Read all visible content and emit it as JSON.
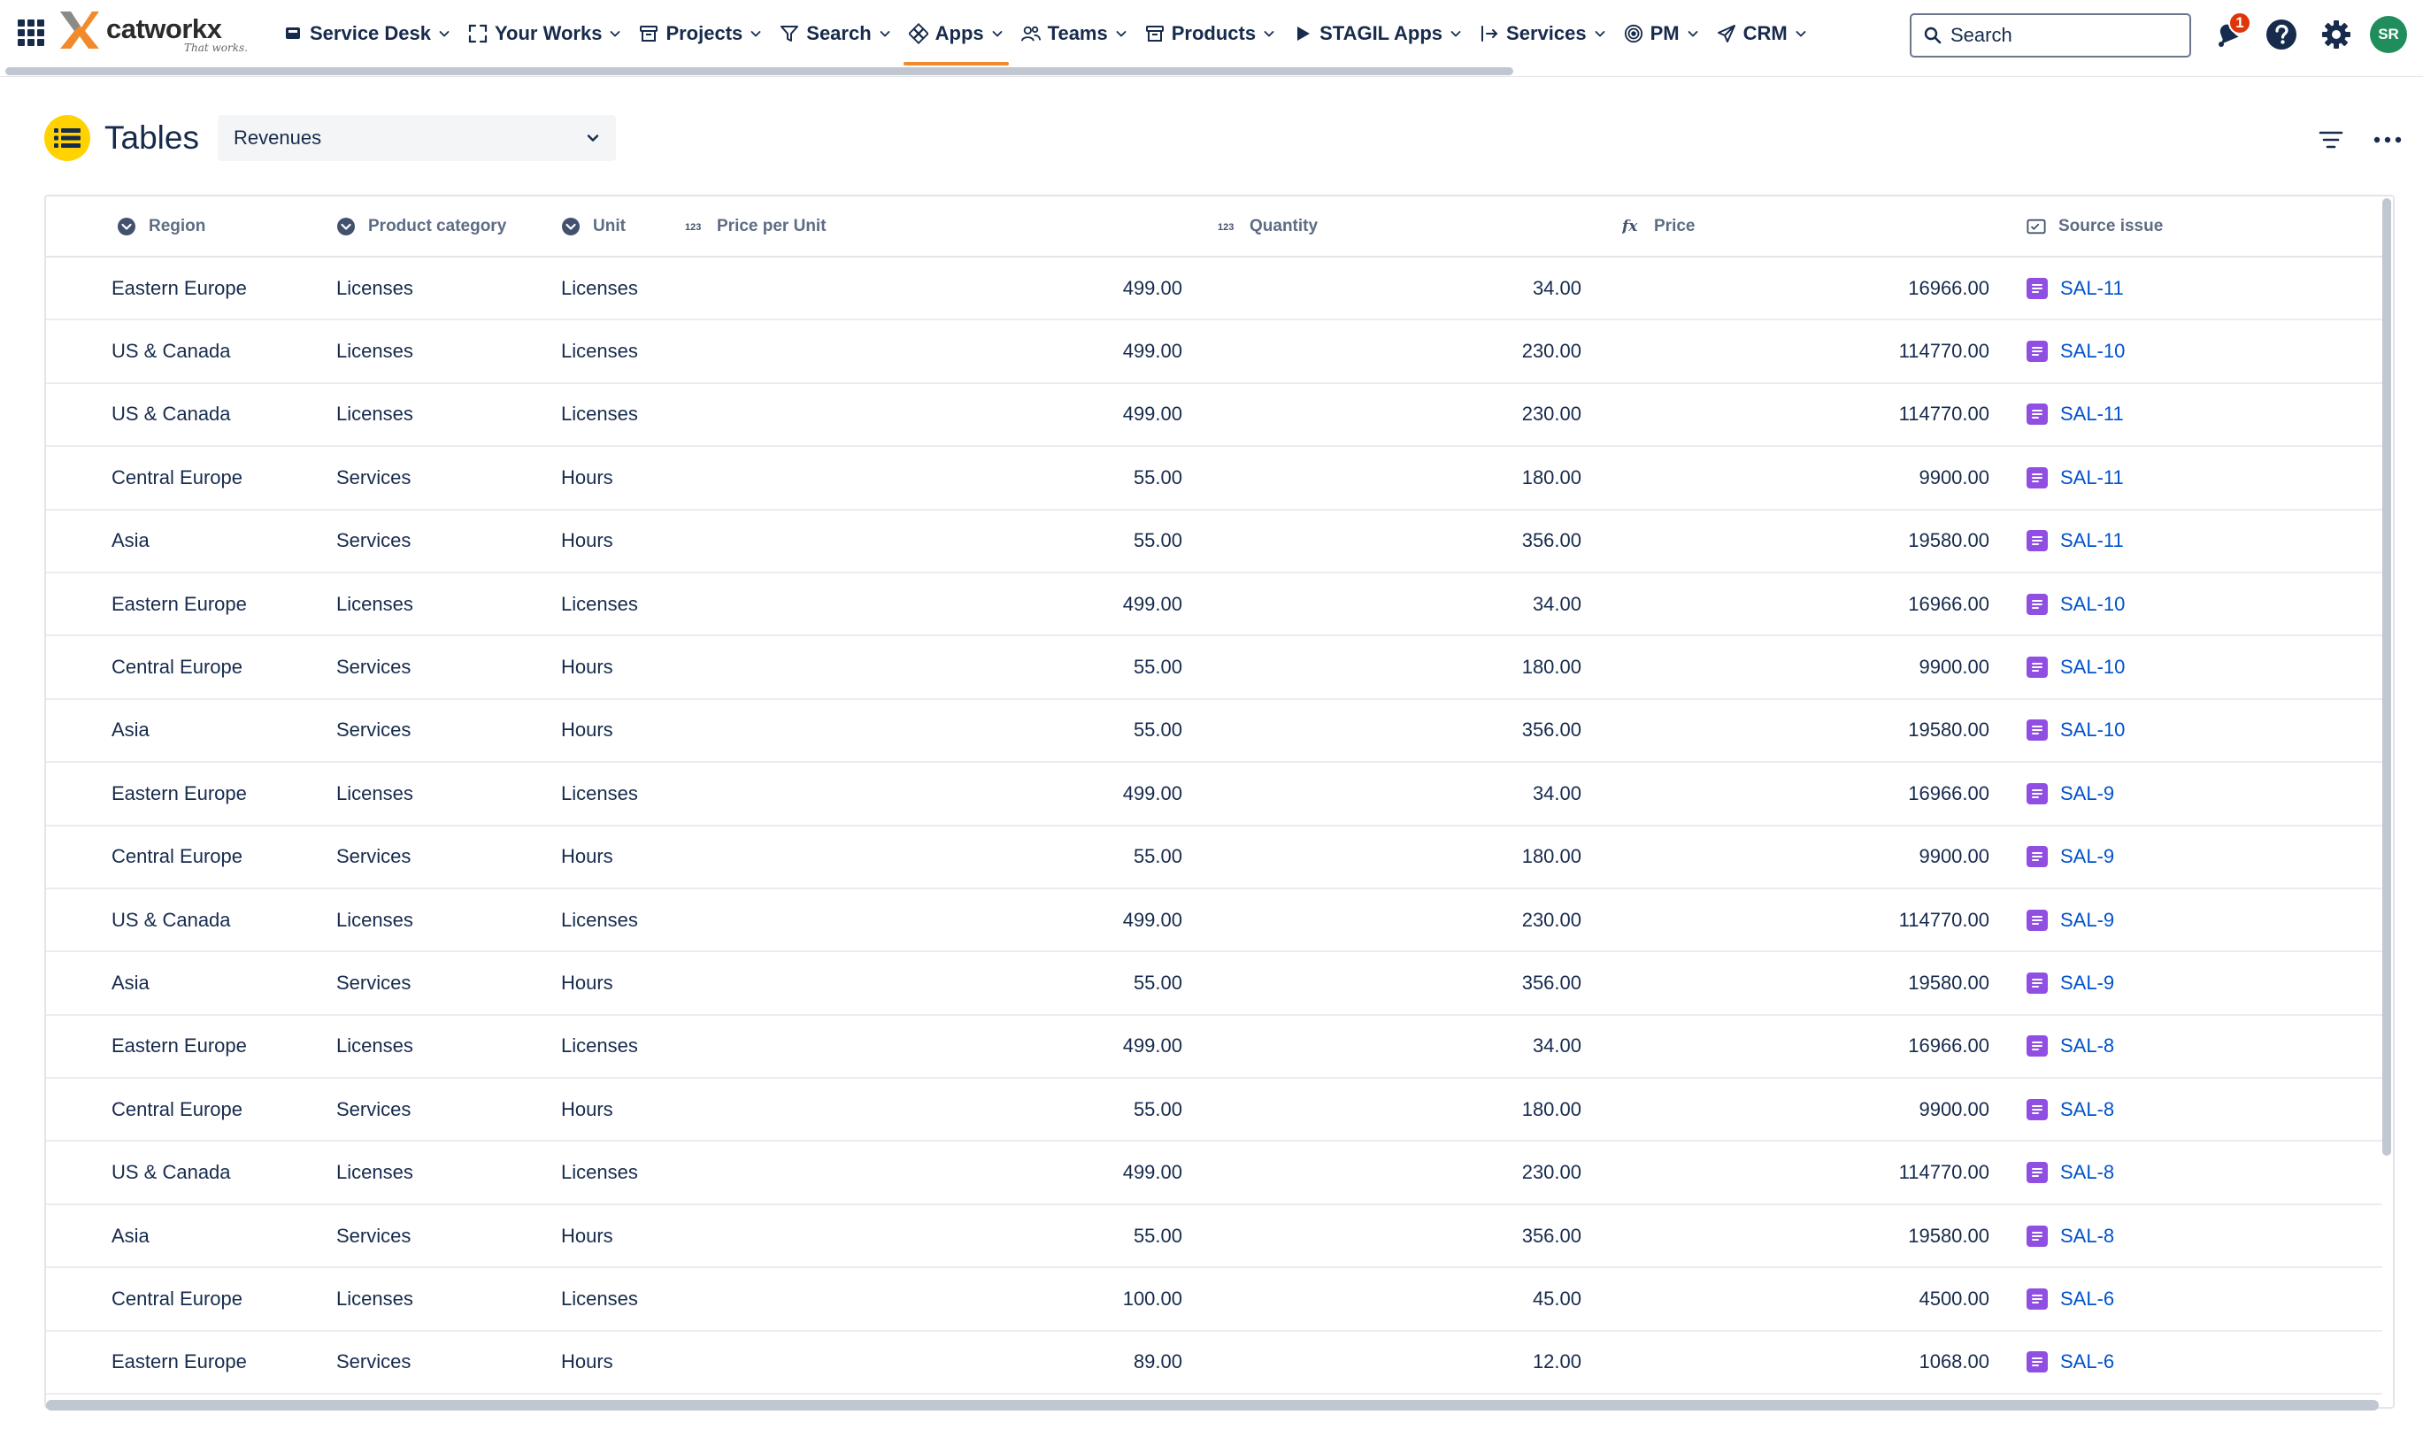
{
  "nav": {
    "logo_name": "catworkx",
    "logo_tagline": "That works.",
    "items": [
      {
        "label": "Service Desk",
        "icon": "service-desk-icon"
      },
      {
        "label": "Your Works",
        "icon": "expand-icon"
      },
      {
        "label": "Projects",
        "icon": "projects-icon"
      },
      {
        "label": "Search",
        "icon": "filter-icon"
      },
      {
        "label": "Apps",
        "icon": "apps-icon",
        "active": true
      },
      {
        "label": "Teams",
        "icon": "teams-icon"
      },
      {
        "label": "Products",
        "icon": "products-icon"
      },
      {
        "label": "STAGIL Apps",
        "icon": "play-icon"
      },
      {
        "label": "Services",
        "icon": "services-icon"
      },
      {
        "label": "PM",
        "icon": "pm-icon"
      },
      {
        "label": "CRM",
        "icon": "send-icon"
      }
    ],
    "search_placeholder": "Search",
    "notification_count": "1",
    "avatar_initials": "SR",
    "active_color": "#f18a2b"
  },
  "page": {
    "title": "Tables",
    "selected_table": "Revenues"
  },
  "table": {
    "columns": [
      {
        "label": "Region",
        "icon": "select-icon"
      },
      {
        "label": "Product category",
        "icon": "select-icon"
      },
      {
        "label": "Unit",
        "icon": "select-icon"
      },
      {
        "label": "Price per Unit",
        "icon": "number-icon"
      },
      {
        "label": "Quantity",
        "icon": "number-icon"
      },
      {
        "label": "Price",
        "icon": "formula-icon"
      },
      {
        "label": "Source issue",
        "icon": "issue-field-icon"
      }
    ],
    "rows": [
      {
        "region": "Eastern Europe",
        "category": "Licenses",
        "unit": "Licenses",
        "ppu": "499.00",
        "qty": "34.00",
        "price": "16966.00",
        "issue": "SAL-11"
      },
      {
        "region": "US & Canada",
        "category": "Licenses",
        "unit": "Licenses",
        "ppu": "499.00",
        "qty": "230.00",
        "price": "114770.00",
        "issue": "SAL-10"
      },
      {
        "region": "US & Canada",
        "category": "Licenses",
        "unit": "Licenses",
        "ppu": "499.00",
        "qty": "230.00",
        "price": "114770.00",
        "issue": "SAL-11"
      },
      {
        "region": "Central Europe",
        "category": "Services",
        "unit": "Hours",
        "ppu": "55.00",
        "qty": "180.00",
        "price": "9900.00",
        "issue": "SAL-11"
      },
      {
        "region": "Asia",
        "category": "Services",
        "unit": "Hours",
        "ppu": "55.00",
        "qty": "356.00",
        "price": "19580.00",
        "issue": "SAL-11"
      },
      {
        "region": "Eastern Europe",
        "category": "Licenses",
        "unit": "Licenses",
        "ppu": "499.00",
        "qty": "34.00",
        "price": "16966.00",
        "issue": "SAL-10"
      },
      {
        "region": "Central Europe",
        "category": "Services",
        "unit": "Hours",
        "ppu": "55.00",
        "qty": "180.00",
        "price": "9900.00",
        "issue": "SAL-10"
      },
      {
        "region": "Asia",
        "category": "Services",
        "unit": "Hours",
        "ppu": "55.00",
        "qty": "356.00",
        "price": "19580.00",
        "issue": "SAL-10"
      },
      {
        "region": "Eastern Europe",
        "category": "Licenses",
        "unit": "Licenses",
        "ppu": "499.00",
        "qty": "34.00",
        "price": "16966.00",
        "issue": "SAL-9"
      },
      {
        "region": "Central Europe",
        "category": "Services",
        "unit": "Hours",
        "ppu": "55.00",
        "qty": "180.00",
        "price": "9900.00",
        "issue": "SAL-9"
      },
      {
        "region": "US & Canada",
        "category": "Licenses",
        "unit": "Licenses",
        "ppu": "499.00",
        "qty": "230.00",
        "price": "114770.00",
        "issue": "SAL-9"
      },
      {
        "region": "Asia",
        "category": "Services",
        "unit": "Hours",
        "ppu": "55.00",
        "qty": "356.00",
        "price": "19580.00",
        "issue": "SAL-9"
      },
      {
        "region": "Eastern Europe",
        "category": "Licenses",
        "unit": "Licenses",
        "ppu": "499.00",
        "qty": "34.00",
        "price": "16966.00",
        "issue": "SAL-8"
      },
      {
        "region": "Central Europe",
        "category": "Services",
        "unit": "Hours",
        "ppu": "55.00",
        "qty": "180.00",
        "price": "9900.00",
        "issue": "SAL-8"
      },
      {
        "region": "US & Canada",
        "category": "Licenses",
        "unit": "Licenses",
        "ppu": "499.00",
        "qty": "230.00",
        "price": "114770.00",
        "issue": "SAL-8"
      },
      {
        "region": "Asia",
        "category": "Services",
        "unit": "Hours",
        "ppu": "55.00",
        "qty": "356.00",
        "price": "19580.00",
        "issue": "SAL-8"
      },
      {
        "region": "Central Europe",
        "category": "Licenses",
        "unit": "Licenses",
        "ppu": "100.00",
        "qty": "45.00",
        "price": "4500.00",
        "issue": "SAL-6"
      },
      {
        "region": "Eastern Europe",
        "category": "Services",
        "unit": "Hours",
        "ppu": "89.00",
        "qty": "12.00",
        "price": "1068.00",
        "issue": "SAL-6"
      }
    ],
    "link_color": "#0052cc",
    "issue_icon_color": "#904ee2"
  }
}
